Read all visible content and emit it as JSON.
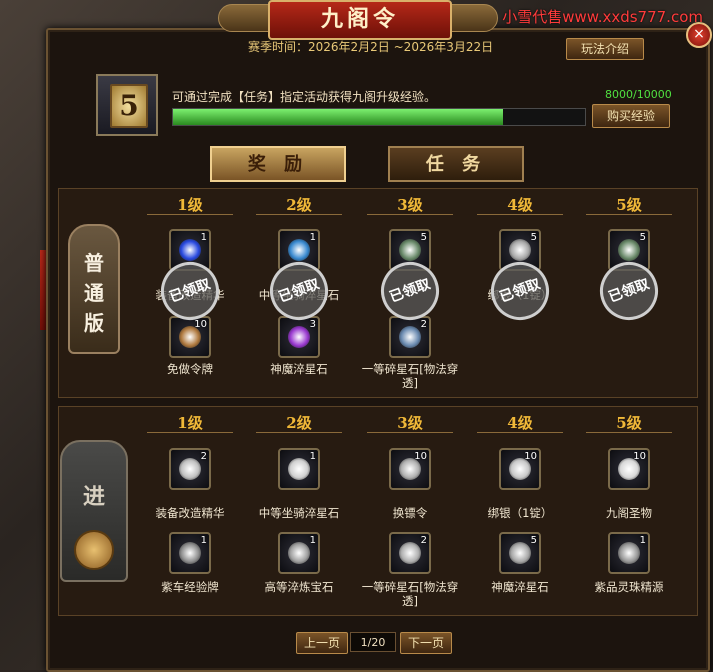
{
  "watermark": "小雪代售www.xxds777.com",
  "window": {
    "title": "九阁令",
    "close_label": "×"
  },
  "season": {
    "label": "赛季时间：2026年2月2日 ~2026年3月22日"
  },
  "rules_button": "玩法介绍",
  "level": {
    "current": "5"
  },
  "exp": {
    "description": "可通过完成【任务】指定活动获得九阁升级经验。",
    "value_text": "8000/10000",
    "progress": 0.8
  },
  "buy_exp_button": "购买经验",
  "tabs": [
    {
      "label": "奖 励",
      "active": true
    },
    {
      "label": "任 务",
      "active": false
    }
  ],
  "normal": {
    "banner": [
      "普",
      "通",
      "版"
    ],
    "levels": [
      "1级",
      "2级",
      "3级",
      "4级",
      "5级"
    ],
    "stamp_text": "已领取",
    "row1": [
      {
        "count": "1",
        "icon": "blue-gem-icon",
        "color": "#2a4ae0"
      },
      {
        "count": "1",
        "icon": "blue-orb-icon",
        "color": "#3a8ad0"
      },
      {
        "count": "5",
        "icon": "green-token-icon",
        "color": "#6a8a6a"
      },
      {
        "count": "5",
        "icon": "silver-ingot-icon",
        "color": "#a8a8a8"
      },
      {
        "count": "5",
        "icon": "green-token-icon",
        "color": "#6a8a6a"
      }
    ],
    "row1_names": [
      "装备改造精华",
      "中等坐骑淬星石",
      "",
      "绑银（1锭）",
      ""
    ],
    "row2": [
      {
        "count": "10",
        "icon": "token-plate-icon",
        "color": "#b07a40",
        "name": "免做令牌"
      },
      {
        "count": "3",
        "icon": "purple-star-stone-icon",
        "color": "#9a3ad0",
        "name": "神魔淬星石"
      },
      {
        "count": "2",
        "icon": "broken-star-stone-icon",
        "color": "#6a8ab0",
        "name": "一等碎星石[物法穿透]"
      }
    ]
  },
  "advanced": {
    "banner": [
      "进"
    ],
    "levels": [
      "1级",
      "2级",
      "3级",
      "4级",
      "5级"
    ],
    "row1": [
      {
        "count": "2",
        "icon": "refine-essence-icon",
        "color": "#c0c0c0",
        "name": "装备改造精华"
      },
      {
        "count": "1",
        "icon": "mount-star-stone-icon",
        "color": "#d0d0d0",
        "name": "中等坐骑淬星石"
      },
      {
        "count": "10",
        "icon": "exchange-token-icon",
        "color": "#b0b0b0",
        "name": "换镖令"
      },
      {
        "count": "10",
        "icon": "silver-ingot-icon",
        "color": "#c8c8c8",
        "name": "绑银（1锭）"
      },
      {
        "count": "10",
        "icon": "jiuge-relic-icon",
        "color": "#d8d8d8",
        "name": "九阁圣物"
      }
    ],
    "row2": [
      {
        "count": "1",
        "icon": "chariot-exp-card-icon",
        "color": "#909090",
        "name": "紫车经验牌"
      },
      {
        "count": "1",
        "icon": "quench-gem-icon",
        "color": "#a0a0a0",
        "name": "高等淬炼宝石"
      },
      {
        "count": "2",
        "icon": "broken-star-stone-icon",
        "color": "#b0b0b0",
        "name": "一等碎星石[物法穿透]"
      },
      {
        "count": "5",
        "icon": "purple-star-stone-icon",
        "color": "#a8a8a8",
        "name": "神魔淬星石"
      },
      {
        "count": "1",
        "icon": "spirit-bead-icon",
        "color": "#989898",
        "name": "紫品灵珠精源"
      }
    ]
  },
  "pager": {
    "prev": "上一页",
    "page": "1/20",
    "next": "下一页"
  }
}
